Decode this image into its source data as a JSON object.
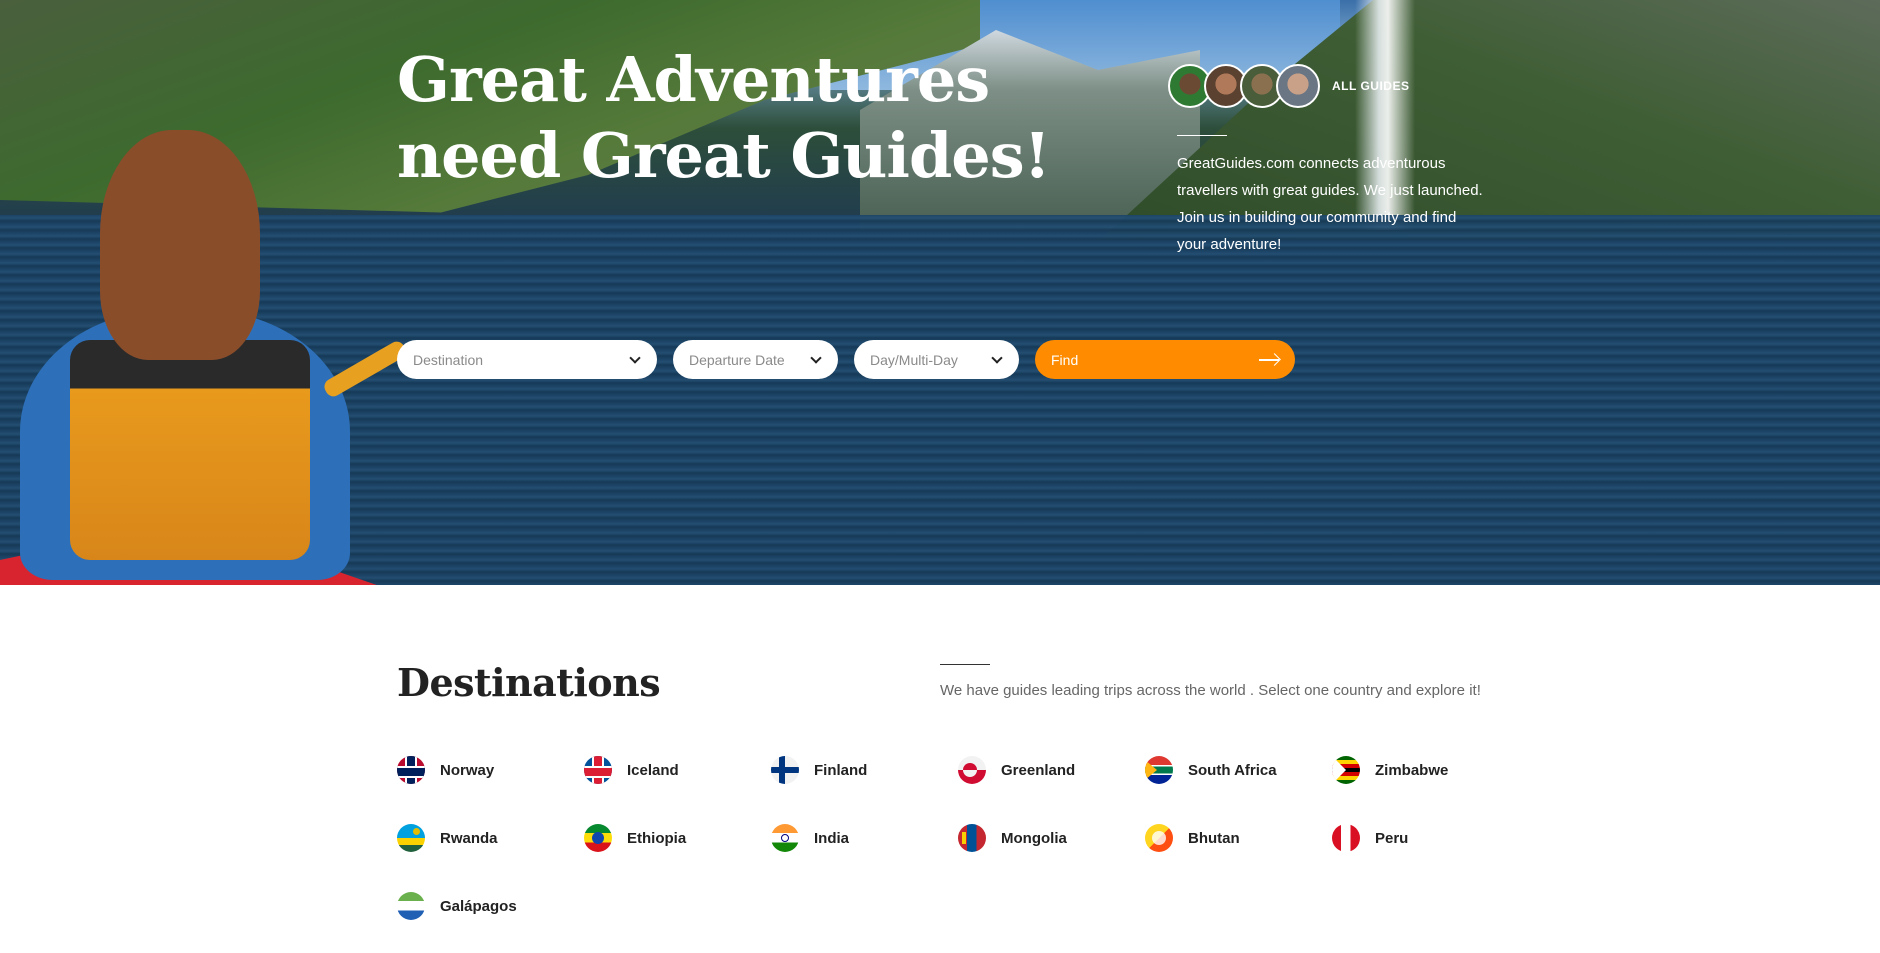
{
  "hero": {
    "headline_line1": "Great Adventures",
    "headline_line2": "need Great Guides!",
    "all_guides_label": "ALL GUIDES",
    "intro": "GreatGuides.com connects adventurous travellers with great guides. We just launched. Join us in building our community and find your adventure!"
  },
  "search": {
    "destination_placeholder": "Destination",
    "date_placeholder": "Departure Date",
    "duration_placeholder": "Day/Multi-Day",
    "find_label": "Find"
  },
  "destinations": {
    "title": "Destinations",
    "subtitle": "We have guides leading trips across the world . Select one country and explore it!",
    "countries": [
      "Norway",
      "Iceland",
      "Finland",
      "Greenland",
      "South Africa",
      "Zimbabwe",
      "Rwanda",
      "Ethiopia",
      "India",
      "Mongolia",
      "Bhutan",
      "Peru",
      "Galápagos"
    ]
  },
  "colors": {
    "accent": "#ff8c00"
  }
}
